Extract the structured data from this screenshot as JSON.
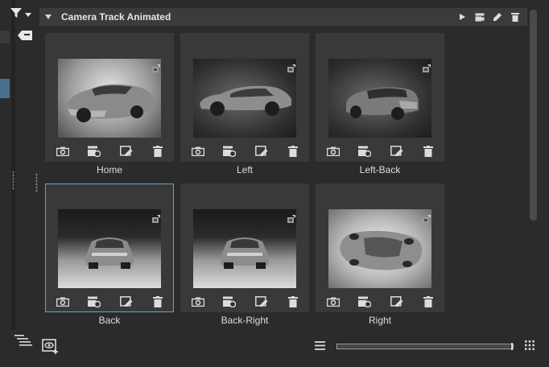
{
  "colors": {
    "background": "#2b2b2b",
    "header_bg": "#3b3b3b",
    "card_bg": "#393939",
    "selected_border": "#5fa3d3",
    "icon": "#d6d6d6"
  },
  "toolbar": {
    "filter_icon": "filter-icon",
    "tag_icon": "tag-icon"
  },
  "header": {
    "title": "Camera Track Animated",
    "actions": [
      "play-icon",
      "record-camera-icon",
      "edit-pencil-icon",
      "delete-trash-icon"
    ]
  },
  "cameras": [
    {
      "label": "Home",
      "selected": false,
      "view": "front-three-quarter"
    },
    {
      "label": "Left",
      "selected": false,
      "view": "side"
    },
    {
      "label": "Left-Back",
      "selected": false,
      "view": "rear-three-quarter"
    },
    {
      "label": "Back",
      "selected": true,
      "view": "rear"
    },
    {
      "label": "Back-Right",
      "selected": false,
      "view": "rear"
    },
    {
      "label": "Right",
      "selected": false,
      "view": "top-down"
    }
  ],
  "card_tools": [
    "camera-icon",
    "record-camera-icon",
    "edit-view-icon",
    "delete-trash-icon"
  ],
  "bottom": {
    "left_icons": [
      "outline-list-icon",
      "add-view-icon"
    ],
    "right_icons": [
      "list-view-icon",
      "grid-view-icon"
    ],
    "thumbnail_size": 1.0
  }
}
